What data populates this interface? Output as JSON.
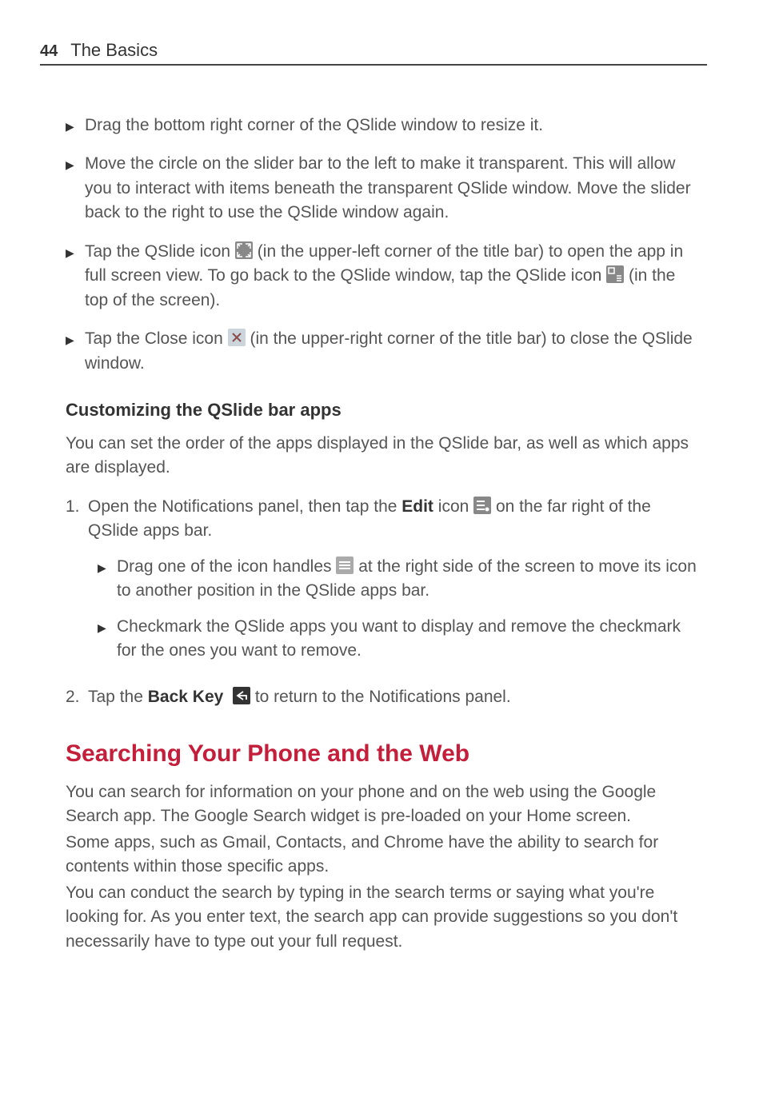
{
  "header": {
    "page_number": "44",
    "title": "The Basics"
  },
  "bullets_top": [
    {
      "text": "Drag the bottom right corner of the QSlide window to resize it."
    },
    {
      "text": "Move the circle on the slider bar to the left to make it transparent. This will allow you to interact with items beneath the transparent QSlide window. Move the slider back to the right to use the QSlide window again."
    },
    {
      "pre_icon": "Tap the QSlide icon ",
      "mid1": " (in the upper-left corner of the title bar) to open the app in full screen view. To go back to the QSlide window, tap the QSlide icon ",
      "post": " (in the top of the screen)."
    },
    {
      "pre_icon": "Tap the Close icon ",
      "post": " (in the upper-right corner of the title bar) to close the QSlide window."
    }
  ],
  "section_customizing": {
    "heading": "Customizing the QSlide bar apps",
    "intro": "You can set the order of the apps displayed in the QSlide bar, as well as which apps are displayed.",
    "step1_pre": "Open the Notifications panel, then tap the ",
    "step1_bold": "Edit",
    "step1_mid": " icon ",
    "step1_post": " on the far right of the QSlide apps bar.",
    "step1_sub1_pre": "Drag one of the icon handles ",
    "step1_sub1_post": " at the right side of the screen to move its icon to another position in the QSlide apps bar.",
    "step1_sub2": "Checkmark the QSlide apps you want to display and remove the checkmark for the ones you want to remove.",
    "step2_pre": "Tap the ",
    "step2_bold": "Back Key",
    "step2_post": " to return to the Notifications panel."
  },
  "section_searching": {
    "heading": "Searching Your Phone and the Web",
    "p1": "You can search for information on your phone and on the web using the Google Search app. The Google Search widget is pre-loaded on your Home screen.",
    "p2": "Some apps, such as Gmail, Contacts, and Chrome have the ability to search for contents within those specific apps.",
    "p3": "You can conduct the search by typing in the search terms or saying what you're looking for. As you enter text, the search app can provide suggestions so you don't necessarily have to type out your full request."
  },
  "numbers": {
    "one": "1.",
    "two": "2."
  }
}
